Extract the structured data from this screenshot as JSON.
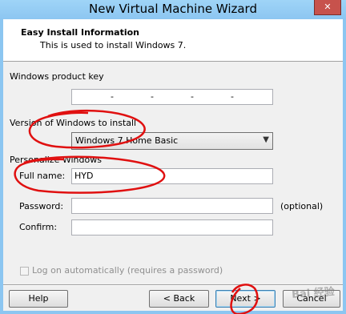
{
  "window": {
    "title": "New Virtual Machine Wizard",
    "close_label": "✕"
  },
  "header": {
    "title": "Easy Install Information",
    "subtitle": "This is used to install Windows 7."
  },
  "product_key": {
    "label": "Windows product key",
    "separators": [
      "-",
      "-",
      "-",
      "-"
    ]
  },
  "version": {
    "label": "Version of Windows to install",
    "selected": "Windows 7 Home Basic"
  },
  "personalize": {
    "label": "Personalize Windows",
    "full_name_label": "Full name:",
    "full_name_value": "HYD",
    "password_label": "Password:",
    "password_value": "",
    "optional_note": "(optional)",
    "confirm_label": "Confirm:",
    "confirm_value": ""
  },
  "autologon": {
    "label": "Log on automatically (requires a password)",
    "checked": false,
    "enabled": false
  },
  "buttons": {
    "help": "Help",
    "back": "< Back",
    "next": "Next >",
    "cancel": "Cancel"
  },
  "watermark": "Bai 经验",
  "colors": {
    "annotation": "#e01010",
    "titlebar": "#8cc6f1"
  }
}
